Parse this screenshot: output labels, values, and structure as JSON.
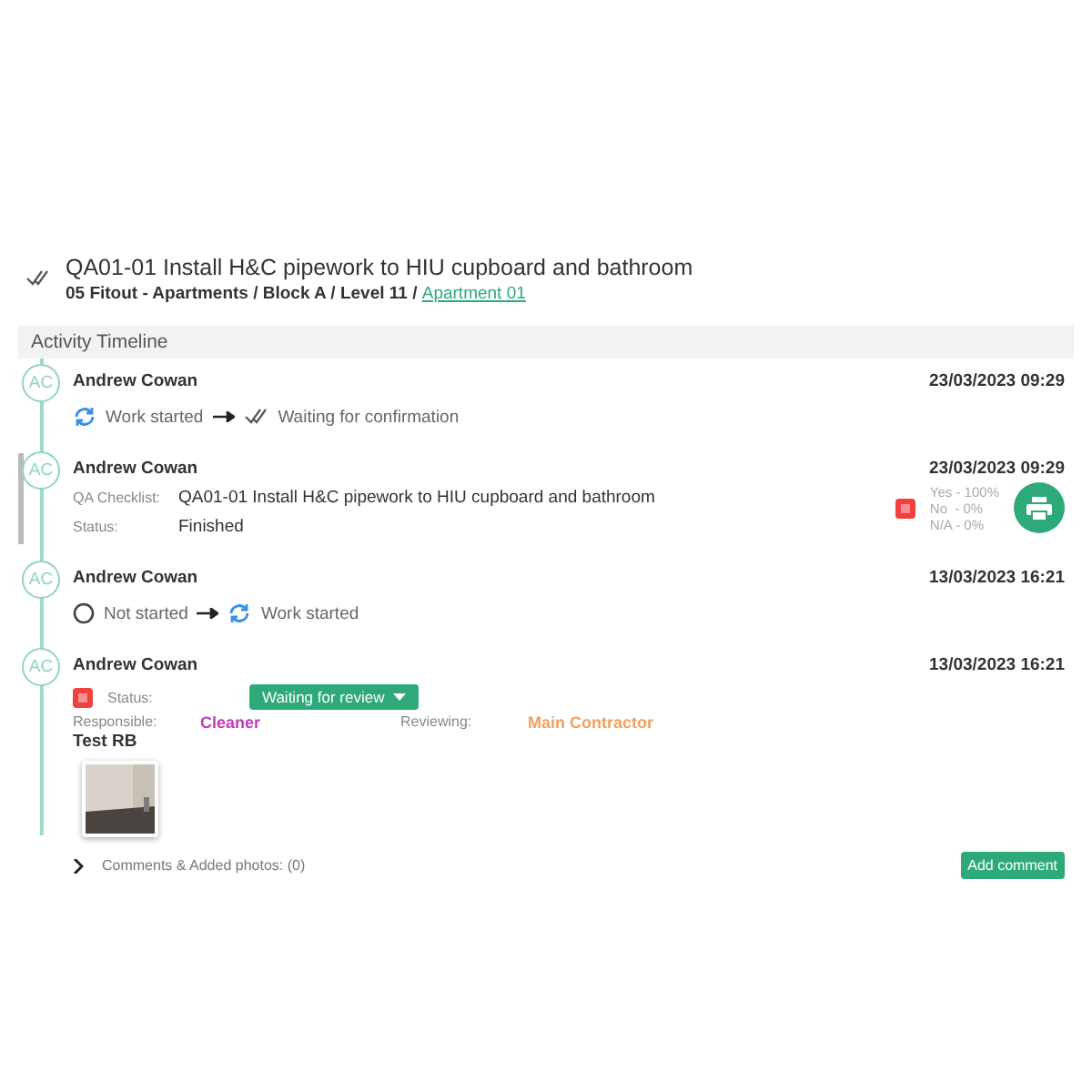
{
  "header": {
    "title": "QA01-01 Install H&C pipework to HIU cupboard and bathroom",
    "path": "05 Fitout - Apartments / Block A / Level 11 / ",
    "link": "Apartment 01"
  },
  "timeline": {
    "title": "Activity Timeline",
    "entries": [
      {
        "kind": "transition",
        "avatar": "AC",
        "author": "Andrew Cowan",
        "date": "23/03/2023 09:29",
        "from": {
          "kind": "sync",
          "label": "Work started"
        },
        "to": {
          "kind": "double_check",
          "label": "Waiting for confirmation"
        }
      },
      {
        "kind": "checklist",
        "avatar": "AC",
        "author": "Andrew Cowan",
        "date": "23/03/2023 09:29",
        "checklist_label": "QA Checklist:",
        "checklist": "QA01-01 Install H&C pipework to HIU cupboard and bathroom",
        "status_label": "Status:",
        "status": "Finished",
        "results": [
          "Yes - 100%",
          "No  - 0%",
          "N/A - 0%"
        ]
      },
      {
        "kind": "transition",
        "avatar": "AC",
        "author": "Andrew Cowan",
        "date": "13/03/2023 16:21",
        "from": {
          "kind": "circle",
          "label": "Not started"
        },
        "to": {
          "kind": "sync",
          "label": "Work started"
        }
      },
      {
        "kind": "review",
        "avatar": "AC",
        "author": "Andrew Cowan",
        "date": "13/03/2023 16:21",
        "status_label": "Status:",
        "status": "Waiting for review",
        "responsible_label": "Responsible:",
        "responsible": {
          "name": "Cleaner",
          "color": "#c03cc0"
        },
        "reviewing_label": "Reviewing:",
        "reviewing": {
          "name": "Main Contractor",
          "color": "#f0a060"
        },
        "note": "Test RB",
        "comments": "Comments & Added photos: (0)",
        "expanded": false,
        "add_button": "Add comment"
      }
    ]
  }
}
